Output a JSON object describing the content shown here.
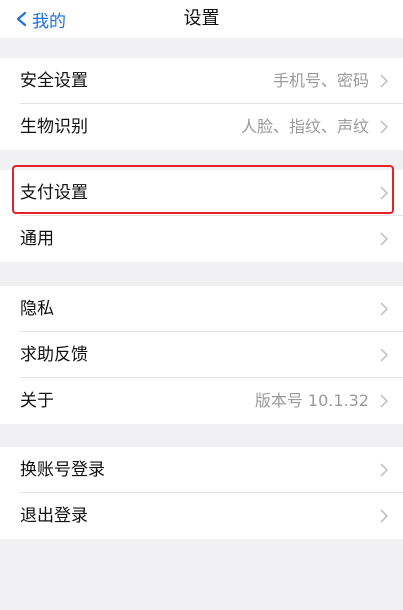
{
  "nav": {
    "back_label": "我的",
    "title": "设置"
  },
  "groups": [
    {
      "items": [
        {
          "label": "安全设置",
          "detail": "手机号、密码"
        },
        {
          "label": "生物识别",
          "detail": "人脸、指纹、声纹"
        }
      ]
    },
    {
      "items": [
        {
          "label": "支付设置",
          "detail": ""
        },
        {
          "label": "通用",
          "detail": ""
        }
      ]
    },
    {
      "items": [
        {
          "label": "隐私",
          "detail": ""
        },
        {
          "label": "求助反馈",
          "detail": ""
        },
        {
          "label": "关于",
          "detail": "版本号 10.1.32"
        }
      ]
    },
    {
      "items": [
        {
          "label": "换账号登录",
          "detail": ""
        },
        {
          "label": "退出登录",
          "detail": ""
        }
      ]
    }
  ],
  "colors": {
    "accent": "#1f6fe5",
    "highlight": "#e5222b",
    "background": "#f1f1f3"
  }
}
